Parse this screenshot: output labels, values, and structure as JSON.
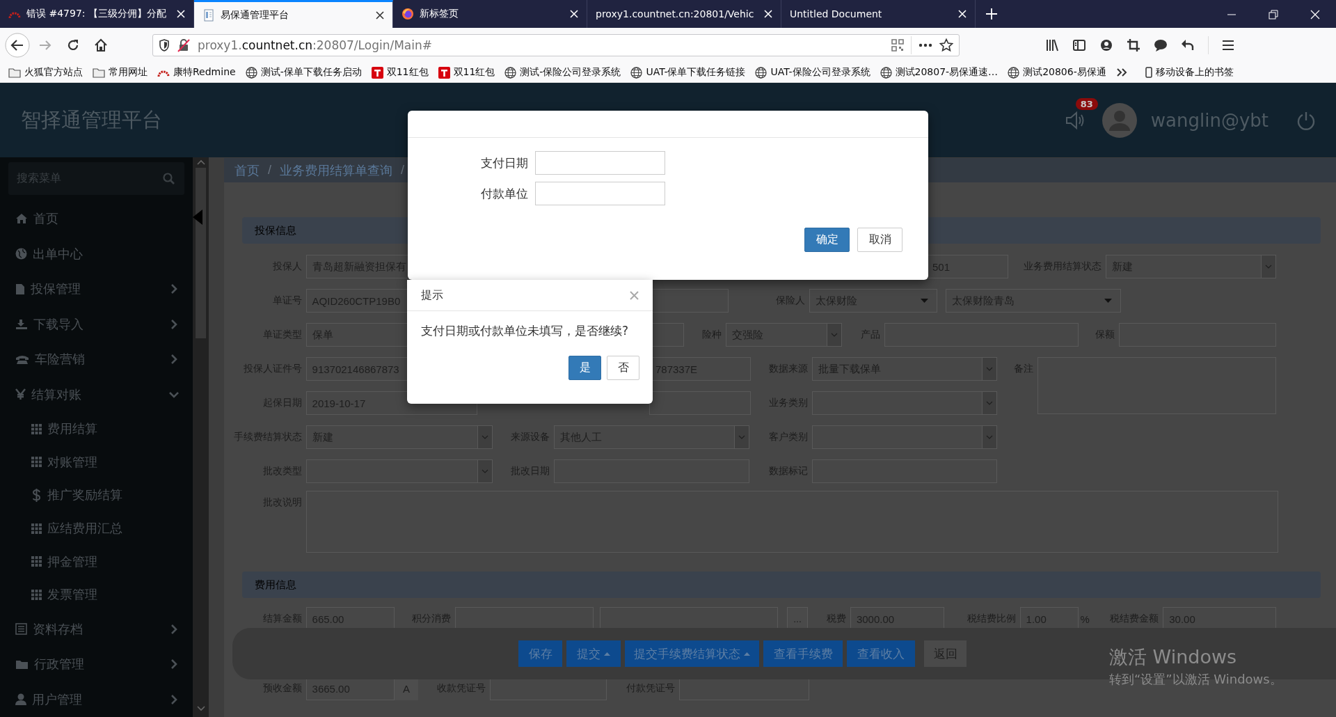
{
  "browser": {
    "tabs": [
      {
        "title": "错误 #4797: 【三级分佣】分配",
        "kind": "redmine",
        "selected": false
      },
      {
        "title": "易保通管理平台",
        "kind": "document",
        "selected": true
      },
      {
        "title": "新标签页",
        "kind": "firefox",
        "selected": false
      },
      {
        "title": "proxy1.countnet.cn:20801/Vehic",
        "kind": "none",
        "selected": false
      },
      {
        "title": "Untitled Document",
        "kind": "none",
        "selected": false
      }
    ],
    "address": {
      "subdomain": "proxy1.",
      "domain": "countnet.cn",
      "path": ":20807/Login/Main#"
    },
    "bookmarks": [
      {
        "label": "火狐官方站点",
        "kind": "folder"
      },
      {
        "label": "常用网址",
        "kind": "folder"
      },
      {
        "label": "康特Redmine",
        "kind": "redmine"
      },
      {
        "label": "测试-保单下载任务启动",
        "kind": "site"
      },
      {
        "label": "双11红包",
        "kind": "tmall"
      },
      {
        "label": "双11红包",
        "kind": "tmall"
      },
      {
        "label": "测试-保险公司登录系统",
        "kind": "site"
      },
      {
        "label": "UAT-保单下载任务链接",
        "kind": "site"
      },
      {
        "label": "UAT-保险公司登录系统",
        "kind": "site"
      },
      {
        "label": "测试20807-易保通速…",
        "kind": "site"
      },
      {
        "label": "测试20806-易保通",
        "kind": "site"
      }
    ],
    "mobile_bookmarks": "移动设备上的书签"
  },
  "app": {
    "title": "智择通管理平台",
    "notification_count": "83",
    "user": "wanglin@ybt"
  },
  "sidebar": {
    "search": {
      "placeholder": "搜索菜单"
    },
    "items": [
      {
        "label": "首页"
      },
      {
        "label": "出单中心"
      },
      {
        "label": "投保管理",
        "expanded": false
      },
      {
        "label": "下载导入",
        "expanded": false
      },
      {
        "label": "车险营销",
        "expanded": false
      },
      {
        "label": "结算对账",
        "expanded": true,
        "children": [
          {
            "label": "费用结算"
          },
          {
            "label": "对账管理"
          },
          {
            "label": "推广奖励结算"
          },
          {
            "label": "应结费用汇总"
          },
          {
            "label": "押金管理"
          },
          {
            "label": "发票管理"
          }
        ]
      },
      {
        "label": "资料存档",
        "expanded": false
      },
      {
        "label": "行政管理",
        "expanded": false
      },
      {
        "label": "用户管理",
        "expanded": false
      }
    ]
  },
  "breadcrumb": {
    "items": [
      "首页",
      "业务费用结算单查询"
    ],
    "separator": "/"
  },
  "form": {
    "sections": [
      {
        "title": "投保信息",
        "fields": [
          {
            "label": "投保人",
            "value": "青岛超新融资担保有",
            "kind": "text"
          },
          {
            "value": "501",
            "kind": "text"
          },
          {
            "label": "业务费用结算状态",
            "value": "新建",
            "kind": "select"
          },
          {
            "label": "单证号",
            "value": "AQID260CTP19B0",
            "kind": "text"
          },
          {
            "kind": "text"
          },
          {
            "label": "保险人",
            "value": "太保财险",
            "kind": "dropdown"
          },
          {
            "value": "太保财险青岛",
            "kind": "dropdown"
          },
          {
            "label": "单证类型",
            "value": "保单",
            "kind": "text"
          },
          {
            "kind": "text"
          },
          {
            "label": "险种",
            "value": "交强险",
            "kind": "select"
          },
          {
            "label": "产品",
            "kind": "text"
          },
          {
            "label": "保额",
            "kind": "text"
          },
          {
            "label": "投保人证件号",
            "value": "913702146867873",
            "kind": "text"
          },
          {
            "value": "787337E",
            "kind": "text"
          },
          {
            "label": "数据来源",
            "value": "批量下载保单",
            "kind": "select"
          },
          {
            "label": "备注",
            "kind": "textarea"
          },
          {
            "label": "起保日期",
            "value": "2019-10-17",
            "kind": "text"
          },
          {
            "kind": "text"
          },
          {
            "label": "业务类别",
            "kind": "select"
          },
          {
            "label": "手续费结算状态",
            "value": "新建",
            "kind": "select"
          },
          {
            "label": "来源设备",
            "value": "其他人工",
            "kind": "select"
          },
          {
            "label": "客户类别",
            "kind": "select"
          },
          {
            "label": "批改类型",
            "kind": "select"
          },
          {
            "label": "批改日期",
            "kind": "text"
          },
          {
            "label": "数据标记",
            "kind": "text"
          },
          {
            "label": "批改说明",
            "kind": "textarea"
          }
        ]
      },
      {
        "title": "费用信息",
        "fields": [
          {
            "label": "结算金额",
            "value": "665.00",
            "kind": "text"
          },
          {
            "label": "积分消费",
            "kind": "text"
          },
          {
            "kind": "text"
          },
          {
            "value": "...",
            "kind": "button"
          },
          {
            "label": "税费",
            "value": "3000.00",
            "kind": "text"
          },
          {
            "label": "税结费比例",
            "value": "1.00",
            "kind": "text"
          },
          {
            "value": "%",
            "kind": "unit"
          },
          {
            "label": "税结费金额",
            "value": "30.00",
            "kind": "text"
          },
          {
            "label": "预收金额",
            "value": "3665.00",
            "kind": "text",
            "addon": "A"
          },
          {
            "label": "收款凭证号",
            "kind": "text"
          },
          {
            "label": "付款凭证号",
            "kind": "text"
          }
        ]
      }
    ]
  },
  "actions": [
    {
      "label": "保存",
      "kind": "primary",
      "caret": false
    },
    {
      "label": "提交",
      "kind": "primary",
      "caret": true
    },
    {
      "label": "提交手续费结算状态",
      "kind": "primary",
      "caret": true
    },
    {
      "label": "查看手续费",
      "kind": "primary",
      "caret": false
    },
    {
      "label": "查看收入",
      "kind": "primary",
      "caret": false
    },
    {
      "label": "返回",
      "kind": "default",
      "caret": false
    }
  ],
  "payment_dialog": {
    "fields": [
      {
        "label": "支付日期"
      },
      {
        "label": "付款单位"
      }
    ],
    "buttons": [
      {
        "label": "确定",
        "kind": "primary"
      },
      {
        "label": "取消",
        "kind": "default"
      }
    ]
  },
  "confirm_dialog": {
    "title": "提示",
    "message": "支付日期或付款单位未填写，是否继续?",
    "buttons": [
      {
        "label": "是",
        "kind": "primary"
      },
      {
        "label": "否",
        "kind": "default"
      }
    ]
  },
  "os_notice": {
    "title": "激活 Windows",
    "subtitle": "转到“设置”以激活 Windows。"
  }
}
